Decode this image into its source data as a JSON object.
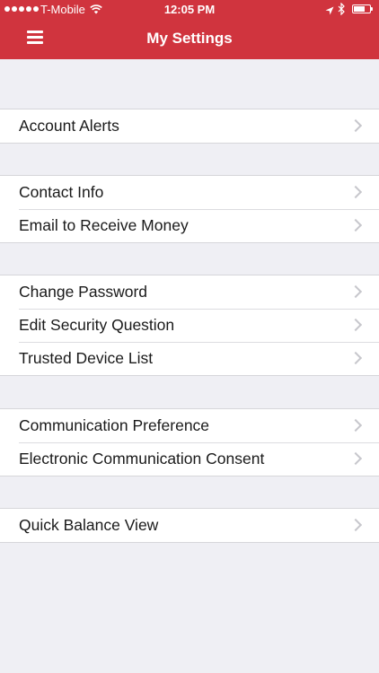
{
  "status_bar": {
    "carrier": "T-Mobile",
    "time": "12:05 PM"
  },
  "header": {
    "title": "My Settings"
  },
  "groups": [
    {
      "items": [
        {
          "label": "Account Alerts"
        }
      ]
    },
    {
      "items": [
        {
          "label": "Contact Info"
        },
        {
          "label": "Email to Receive Money"
        }
      ]
    },
    {
      "items": [
        {
          "label": "Change Password"
        },
        {
          "label": "Edit Security Question"
        },
        {
          "label": "Trusted Device List"
        }
      ]
    },
    {
      "items": [
        {
          "label": "Communication Preference"
        },
        {
          "label": "Electronic Communication Consent"
        }
      ]
    },
    {
      "items": [
        {
          "label": "Quick Balance View"
        }
      ]
    }
  ],
  "colors": {
    "header_background": "#d0343e",
    "page_background": "#efeff4",
    "row_background": "#ffffff",
    "chevron": "#c7c7cc"
  },
  "icons": [
    "signal-dots-icon",
    "wifi-icon",
    "location-arrow-icon",
    "bluetooth-icon",
    "battery-icon",
    "hamburger-menu-icon",
    "chevron-right-icon"
  ]
}
